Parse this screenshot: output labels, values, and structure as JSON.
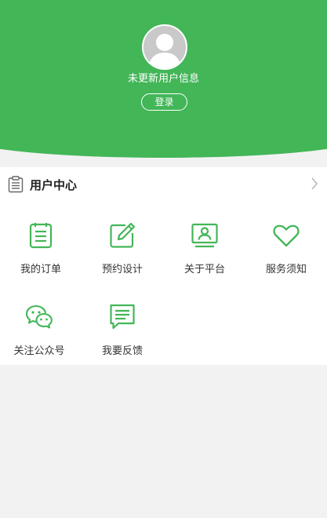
{
  "profile": {
    "info_text": "未更新用户信息",
    "login_label": "登录"
  },
  "user_center": {
    "title": "用户中心",
    "items": [
      {
        "label": "我的订单",
        "icon": "order-list-icon"
      },
      {
        "label": "预约设计",
        "icon": "edit-pencil-icon"
      },
      {
        "label": "关于平台",
        "icon": "monitor-user-icon"
      },
      {
        "label": "服务须知",
        "icon": "heart-icon"
      },
      {
        "label": "关注公众号",
        "icon": "wechat-icon"
      },
      {
        "label": "我要反馈",
        "icon": "feedback-message-icon"
      }
    ]
  },
  "colors": {
    "accent": "#43b658",
    "background": "#f2f2f2"
  }
}
